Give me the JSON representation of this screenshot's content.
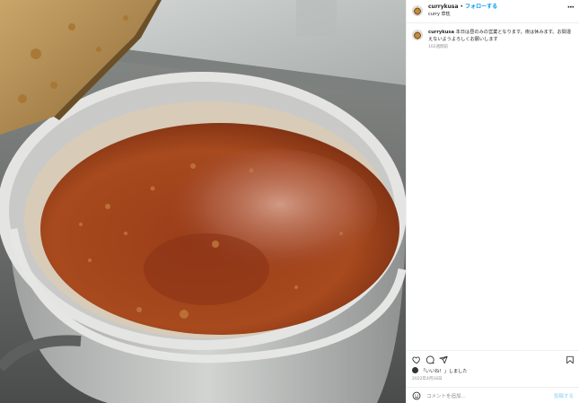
{
  "post": {
    "username": "currykusa",
    "dot": "•",
    "follow_label": "フォローする",
    "location": "curry 草枕",
    "more_icon": "more-horizontal-icon",
    "caption_text": "本日は昼のみの営業となります。夜は休みます。お間違えないようよろしくお願いします",
    "caption_time": "102週間前",
    "liked_by_user": "",
    "liked_text": "「いいね！」しました",
    "date": "2022年4月18日",
    "comment_placeholder": "コメントを追加...",
    "post_button": "投稿する"
  },
  "icons": {
    "like": "heart-icon",
    "comment": "comment-icon",
    "share": "send-icon",
    "save": "bookmark-icon",
    "emoji": "emoji-icon"
  },
  "colors": {
    "accent": "#0095f6",
    "post_disabled": "#b2dffc",
    "muted": "#8e8e8e",
    "curry": "#a8461d"
  }
}
